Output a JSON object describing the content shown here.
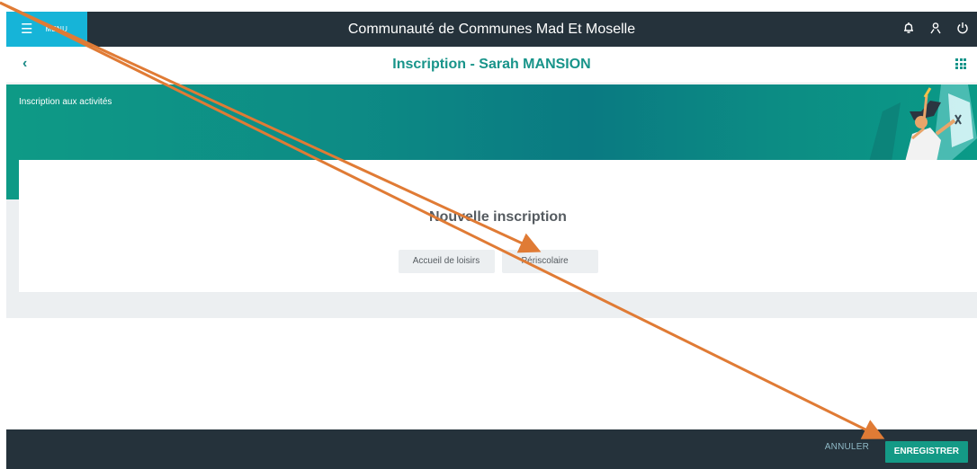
{
  "header": {
    "menu_label": "MENU",
    "app_title": "Communauté de Communes Mad Et Moselle"
  },
  "subheader": {
    "title": "Inscription  -  Sarah MANSION"
  },
  "banner": {
    "label": "Inscription aux activités"
  },
  "card": {
    "title": "Nouvelle inscription",
    "options": [
      "Accueil de loisirs",
      "Périscolaire"
    ]
  },
  "footer": {
    "cancel_label": "ANNULER",
    "save_label": "ENREGISTRER"
  },
  "colors": {
    "topbar": "#25323b",
    "menu_accent": "#16b4d8",
    "brand_teal": "#18948a",
    "annotation_arrow": "#e07b35"
  },
  "icons": [
    "menu-icon",
    "bell-icon",
    "user-icon",
    "power-icon",
    "back-chevron-icon",
    "apps-grid-icon"
  ]
}
